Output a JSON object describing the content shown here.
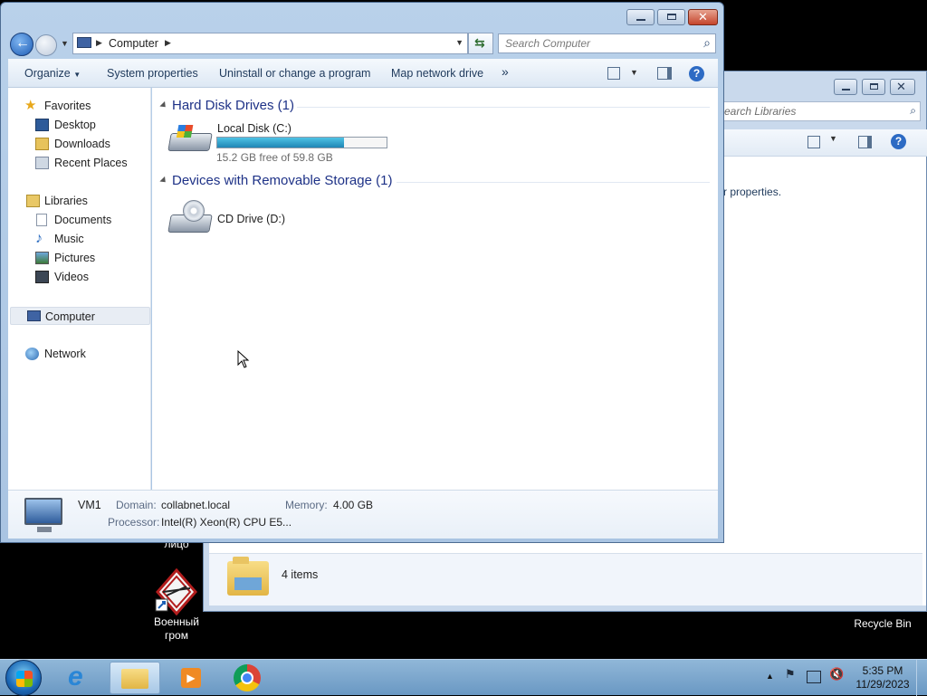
{
  "desktop": {
    "icons": [
      {
        "label": "лицо"
      },
      {
        "label": "Военный\nгром"
      },
      {
        "label": "Recycle Bin"
      }
    ]
  },
  "back_window": {
    "search_placeholder": "Search Libraries",
    "partial_text": "r properties.",
    "status_text": "4 items"
  },
  "front_window": {
    "address": {
      "location": "Computer"
    },
    "search_placeholder": "Search Computer",
    "commands": [
      {
        "label": "Organize"
      },
      {
        "label": "System properties"
      },
      {
        "label": "Uninstall or change a program"
      },
      {
        "label": "Map network drive"
      }
    ],
    "more_glyph": "»",
    "nav": {
      "favorites": "Favorites",
      "desktop": "Desktop",
      "downloads": "Downloads",
      "recent": "Recent Places",
      "libraries": "Libraries",
      "documents": "Documents",
      "music": "Music",
      "pictures": "Pictures",
      "videos": "Videos",
      "computer": "Computer",
      "network": "Network"
    },
    "groups": {
      "hdd": {
        "title": "Hard Disk Drives (1)",
        "drive_name": "Local Disk (C:)",
        "free_text": "15.2 GB free of 59.8 GB",
        "used_fraction": 0.746
      },
      "removable": {
        "title": "Devices with Removable Storage (1)",
        "drive_name": "CD Drive (D:)"
      }
    },
    "details": {
      "name": "VM1",
      "domain_label": "Domain:",
      "domain_value": "collabnet.local",
      "memory_label": "Memory:",
      "memory_value": "4.00 GB",
      "processor_label": "Processor:",
      "processor_value": "Intel(R) Xeon(R) CPU E5..."
    }
  },
  "taskbar": {
    "time": "5:35 PM",
    "date": "11/29/2023"
  }
}
